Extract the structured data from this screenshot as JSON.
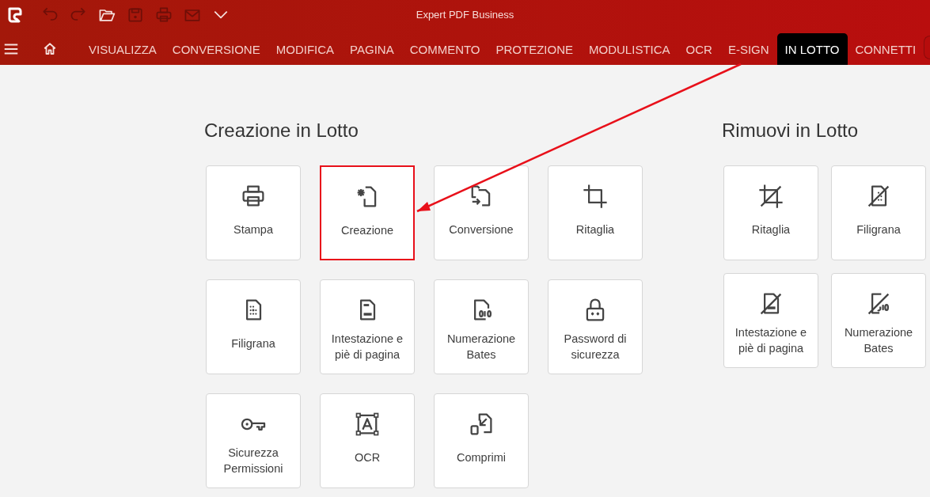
{
  "window": {
    "title": "Expert PDF Business"
  },
  "toolbar": [
    {
      "disabled": true
    },
    {
      "disabled": true
    },
    {
      "disabled": false
    },
    {
      "disabled": true
    },
    {
      "disabled": true
    },
    {
      "disabled": true
    },
    {
      "disabled": false
    }
  ],
  "tabs": [
    {
      "label": "VISUALIZZA",
      "selected": false
    },
    {
      "label": "CONVERSIONE",
      "selected": false
    },
    {
      "label": "MODIFICA",
      "selected": false
    },
    {
      "label": "PAGINA",
      "selected": false
    },
    {
      "label": "COMMENTO",
      "selected": false
    },
    {
      "label": "PROTEZIONE",
      "selected": false
    },
    {
      "label": "MODULISTICA",
      "selected": false
    },
    {
      "label": "OCR",
      "selected": false
    },
    {
      "label": "E-SIGN",
      "selected": false
    },
    {
      "label": "IN LOTTO",
      "selected": true
    },
    {
      "label": "CONNETTI",
      "selected": false
    }
  ],
  "sections": [
    {
      "title": "Creazione in Lotto",
      "tiles": [
        {
          "label": "Stampa",
          "highlighted": false
        },
        {
          "label": "Creazione",
          "highlighted": true
        },
        {
          "label": "Conversione",
          "highlighted": false
        },
        {
          "label": "Ritaglia",
          "highlighted": false
        },
        {
          "label": "Filigrana",
          "highlighted": false
        },
        {
          "label": "Intestazione e piè di pagina",
          "highlighted": false
        },
        {
          "label": "Numerazione Bates",
          "highlighted": false
        },
        {
          "label": "Password di sicurezza",
          "highlighted": false
        },
        {
          "label": "Sicurezza Permissioni",
          "highlighted": false
        },
        {
          "label": "OCR",
          "highlighted": false
        },
        {
          "label": "Comprimi",
          "highlighted": false
        }
      ]
    },
    {
      "title": "Rimuovi in Lotto",
      "tiles": [
        {
          "label": "Ritaglia",
          "highlighted": false
        },
        {
          "label": "Filigrana",
          "highlighted": false
        },
        {
          "label": "Intestazione e piè di pagina",
          "highlighted": false
        },
        {
          "label": "Numerazione Bates",
          "highlighted": false
        }
      ]
    }
  ]
}
